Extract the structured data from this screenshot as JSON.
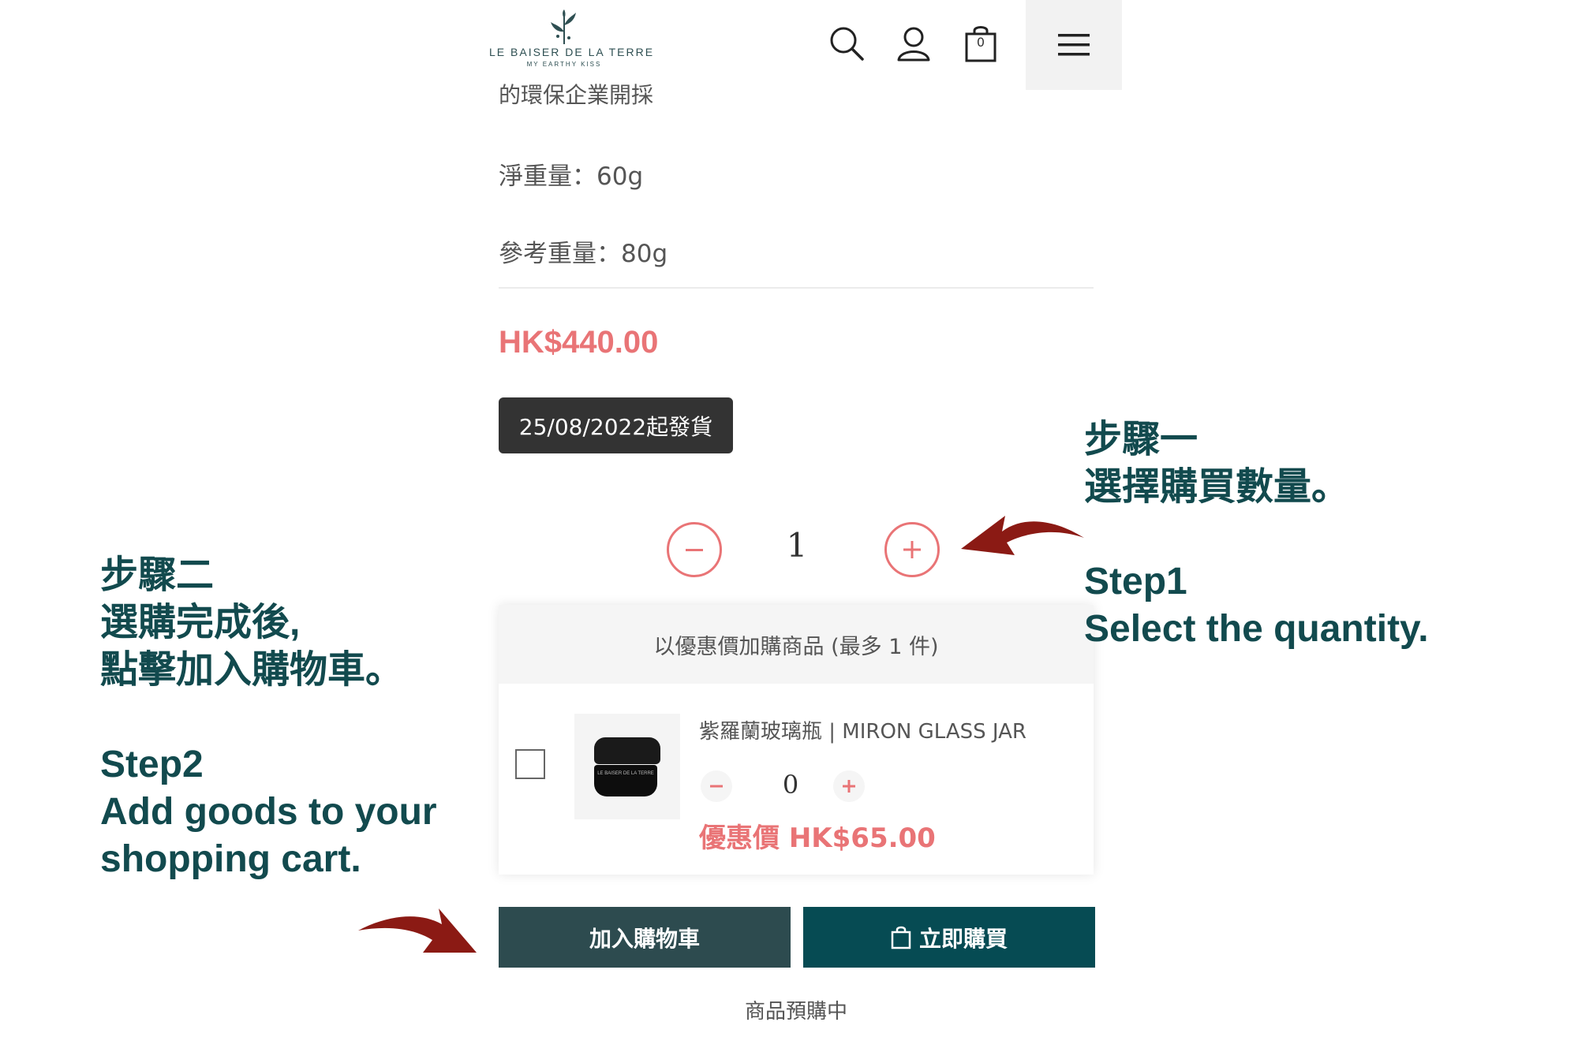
{
  "header": {
    "brand": "LE BAISER DE LA TERRE",
    "tagline": "MY EARTHY KISS",
    "cart_count": "0"
  },
  "product": {
    "cut_text": "的環保企業開採",
    "net_weight": "淨重量：60g",
    "ref_weight": "參考重量：80g",
    "price": "HK$440.00",
    "ship_date": "25/08/2022起發貨",
    "quantity": "1"
  },
  "addon": {
    "heading": "以優惠價加購商品 (最多 1 件)",
    "item_name": "紫羅蘭玻璃瓶 | MIRON GLASS JAR",
    "item_qty": "0",
    "item_price": "優惠價 HK$65.00",
    "jar_label": "LE BAISER DE LA TERRE"
  },
  "actions": {
    "add_to_cart": "加入購物車",
    "buy_now": "立即購買",
    "preorder": "商品預購中"
  },
  "annotations": {
    "step1_line1": "步驟一",
    "step1_line2": "選擇購買數量。",
    "step1_en_line1": "Step1",
    "step1_en_line2": "Select the quantity.",
    "step2_line1": "步驟二",
    "step2_line2": "選購完成後,",
    "step2_line3": "點擊加入購物車。",
    "step2_en_line1": "Step2",
    "step2_en_line2": "Add goods to your",
    "step2_en_line3": "shopping cart."
  },
  "colors": {
    "accent": "#e97476",
    "brand_green": "#124a4e",
    "arrow_red": "#8b1a14"
  }
}
